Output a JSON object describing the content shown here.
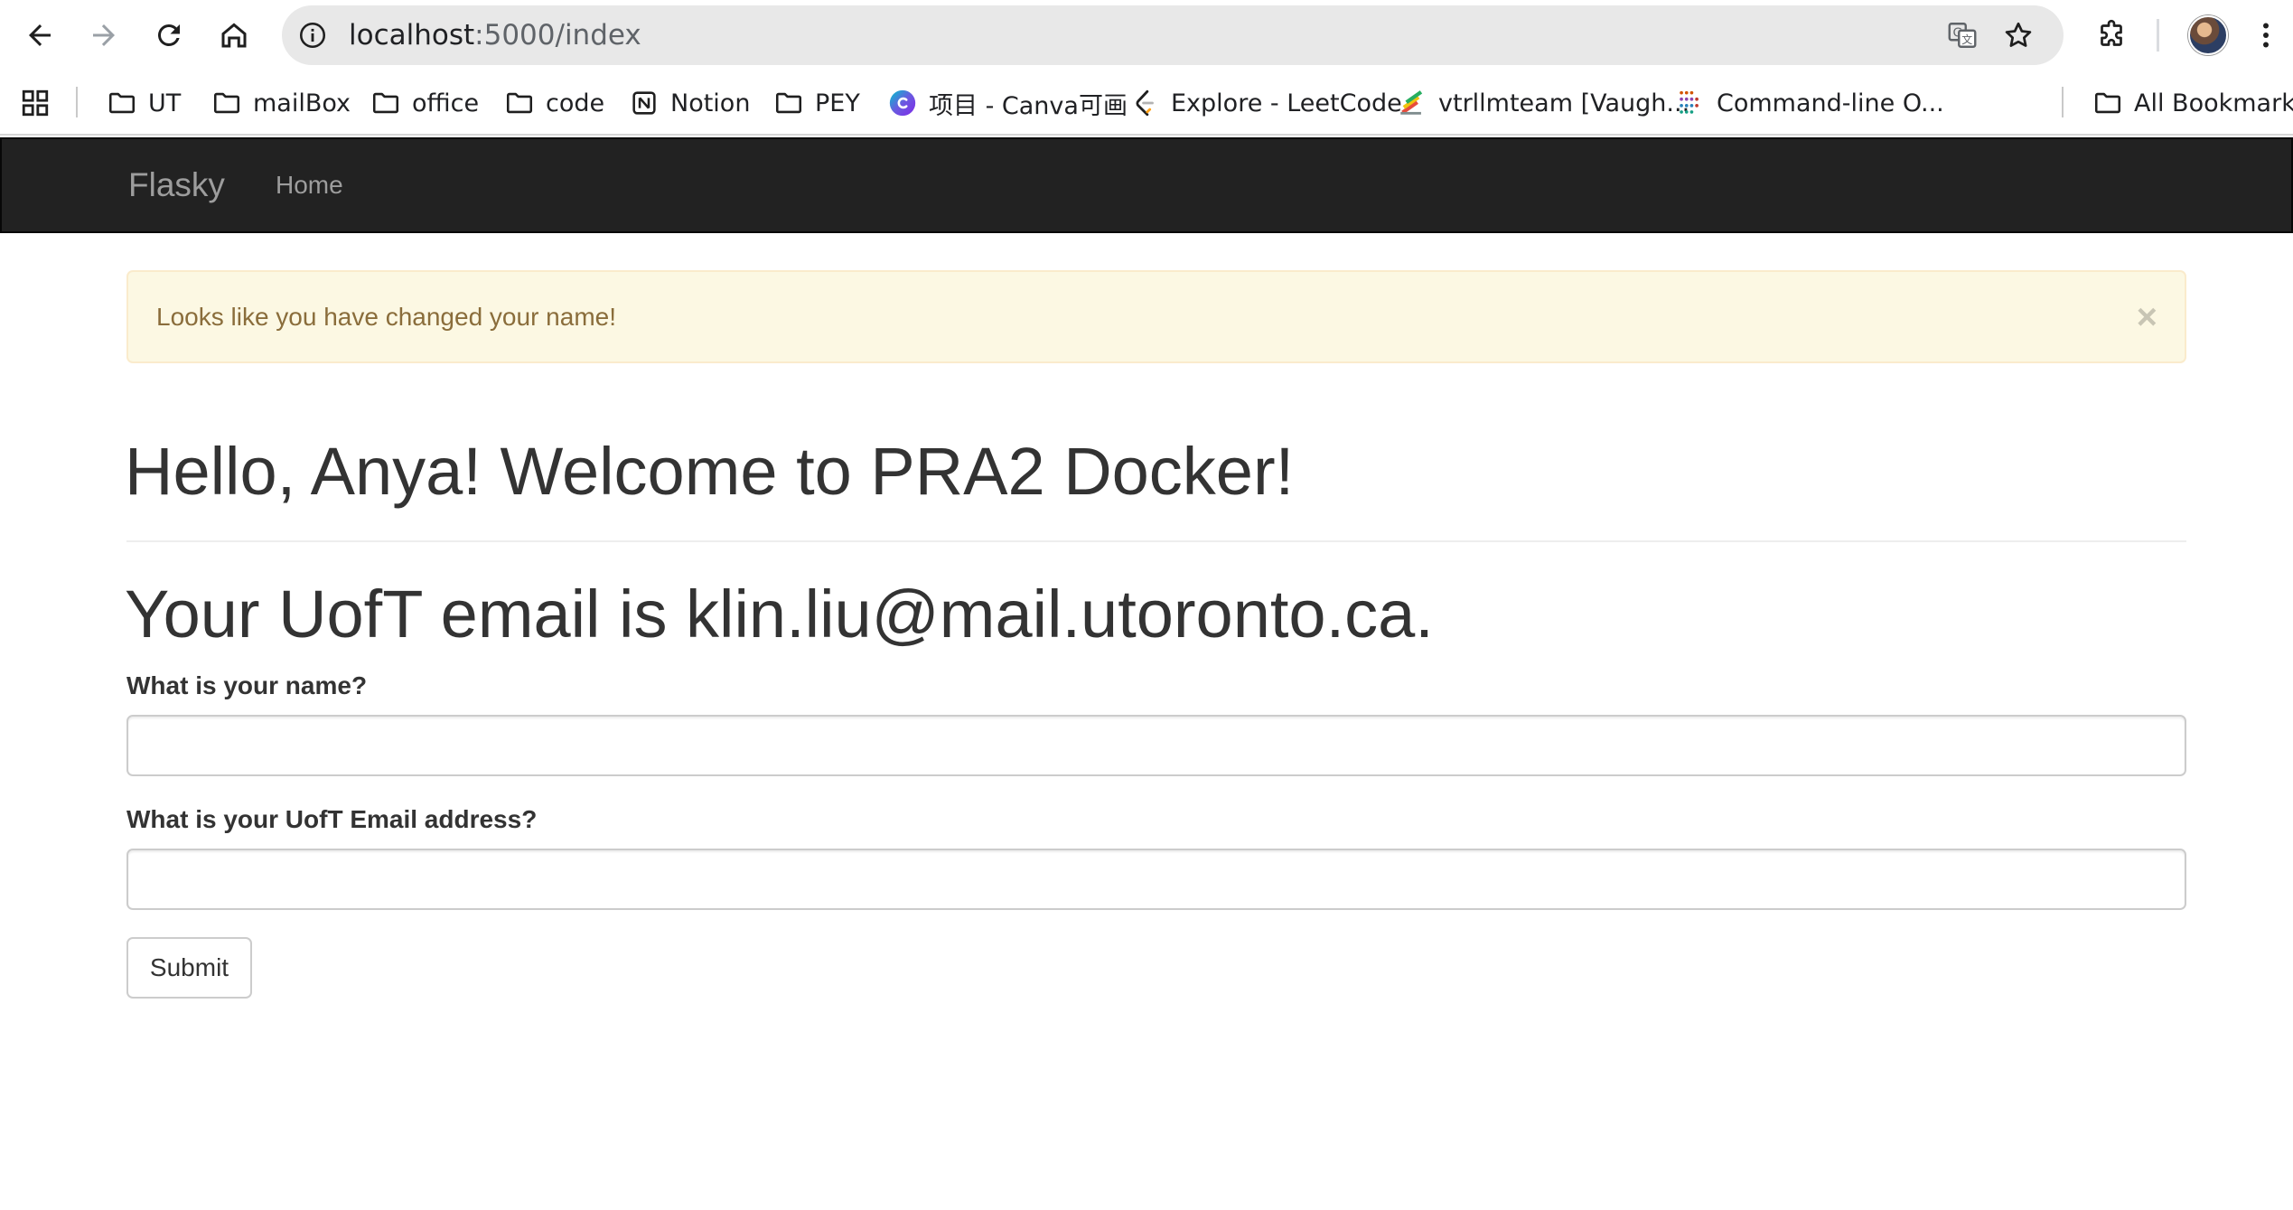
{
  "browser": {
    "url_host": "localhost",
    "url_path": ":5000/index",
    "icons": {
      "back": "back-arrow-icon",
      "forward": "forward-arrow-icon",
      "reload": "reload-icon",
      "home": "home-icon",
      "site_info": "site-info-icon",
      "translate": "translate-icon",
      "bookmark_star": "star-icon",
      "extensions": "puzzle-icon",
      "menu": "kebab-menu-icon"
    }
  },
  "bookmarks": {
    "items": [
      {
        "label": "UT",
        "icon": "folder-icon"
      },
      {
        "label": "mailBox",
        "icon": "folder-icon"
      },
      {
        "label": "office",
        "icon": "folder-icon"
      },
      {
        "label": "code",
        "icon": "folder-icon"
      },
      {
        "label": "Notion",
        "icon": "notion-icon"
      },
      {
        "label": "PEY",
        "icon": "folder-icon"
      },
      {
        "label": "项目 - Canva可画",
        "icon": "canva-icon"
      },
      {
        "label": "Explore - LeetCode",
        "icon": "leetcode-icon"
      },
      {
        "label": "vtrllmteam [Vaugh...",
        "icon": "colorful-pencils-icon"
      },
      {
        "label": "Command-line O...",
        "icon": "dots-grid-icon"
      }
    ],
    "all_bookmarks": "All Bookmarks"
  },
  "navbar": {
    "brand": "Flasky",
    "home": "Home"
  },
  "alert": {
    "message": "Looks like you have changed your name!",
    "close": "×"
  },
  "main": {
    "greeting": "Hello, Anya! Welcome to PRA2 Docker!",
    "email_line": "Your UofT email is klin.liu@mail.utoronto.ca."
  },
  "form": {
    "name_label": "What is your name?",
    "name_value": "",
    "email_label": "What is your UofT Email address?",
    "email_value": "",
    "submit_label": "Submit"
  },
  "colors": {
    "navbar_bg": "#222222",
    "navbar_text": "#9d9d9d",
    "alert_bg": "#fcf8e3",
    "alert_text": "#8a6d3b",
    "alert_border": "#faebcc",
    "heading_text": "#333333"
  }
}
